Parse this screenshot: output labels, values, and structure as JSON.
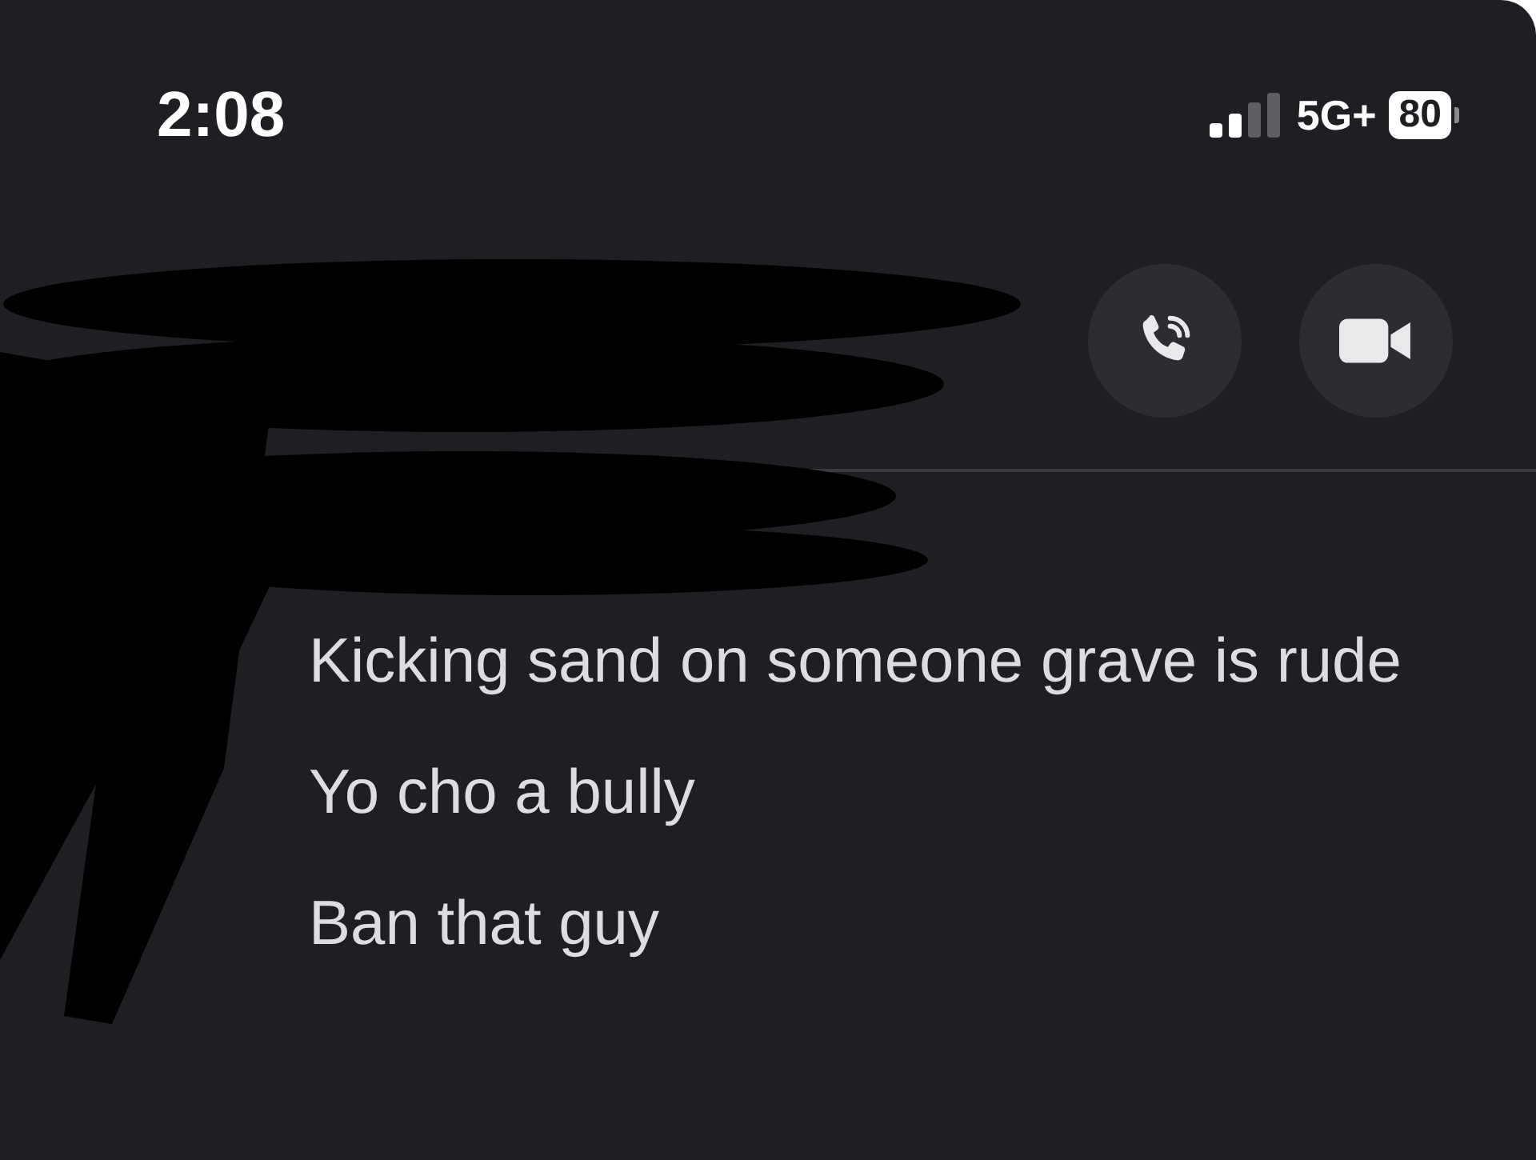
{
  "status_bar": {
    "time": "2:08",
    "network": "5G+",
    "battery": "80"
  },
  "header": {
    "buttons": [
      {
        "kind": "call"
      },
      {
        "kind": "video"
      }
    ]
  },
  "messages": [
    {
      "text": "Kicking sand on someone grave is rude"
    },
    {
      "text": "Yo cho a bully"
    },
    {
      "text": "Ban that guy"
    }
  ]
}
